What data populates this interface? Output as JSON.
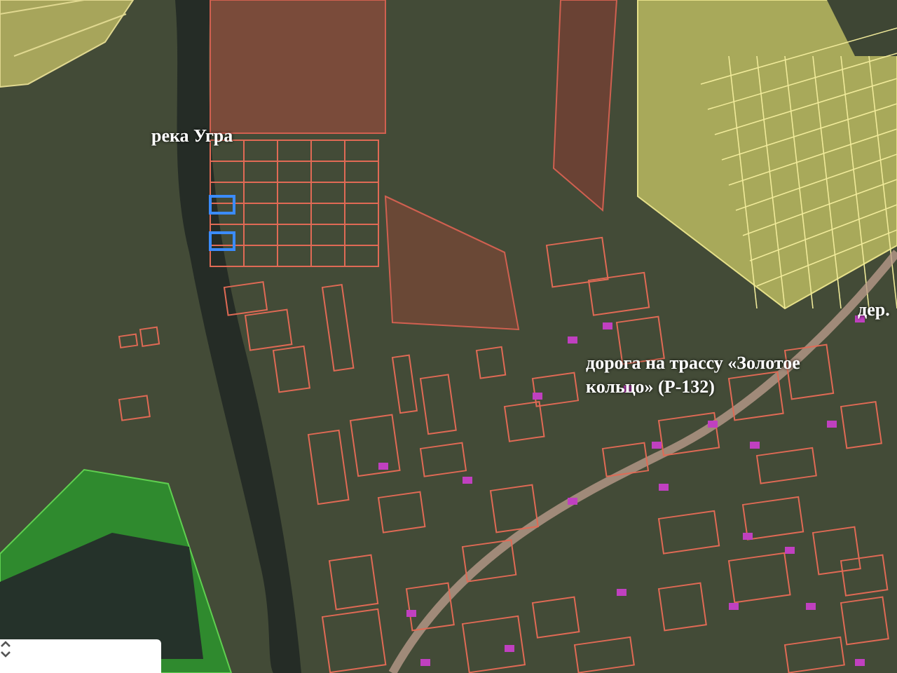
{
  "map": {
    "labels": [
      {
        "text": "река Угра"
      },
      {
        "text": "дорога на трассу «Золотое кольцо» (Р-132)"
      },
      {
        "text": "дер."
      }
    ]
  }
}
